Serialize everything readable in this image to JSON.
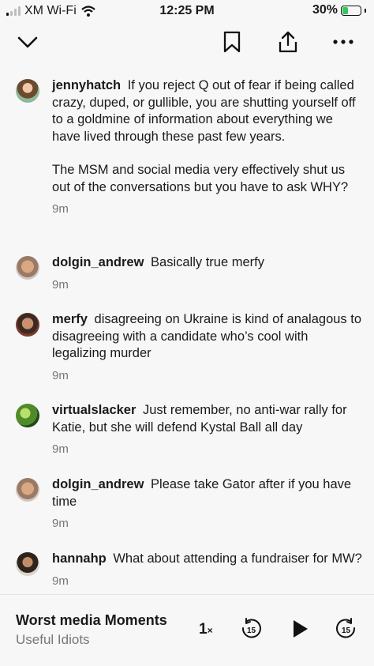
{
  "status_bar": {
    "carrier": "XM Wi-Fi",
    "time": "12:25 PM",
    "battery": "30%"
  },
  "topbar": {
    "icons": [
      "chevron-down-icon",
      "bookmark-icon",
      "share-icon",
      "more-icon"
    ]
  },
  "comments": [
    {
      "user": "jennyhatch",
      "text": "If you reject Q out of fear if being called crazy, duped, or gullible, you are shutting yourself off to a goldmine of information about everything we have lived through these past few years.",
      "text2": "The MSM and social media very effectively shut us out of the conversations but you have to ask WHY?",
      "time": "9m"
    },
    {
      "user": "dolgin_andrew",
      "text": "Basically true merfy",
      "time": "9m"
    },
    {
      "user": "merfy",
      "text": "disagreeing on Ukraine is kind of analagous to disagreeing with a candidate who’s cool with legalizing murder",
      "time": "9m"
    },
    {
      "user": "virtualslacker",
      "text": "Just remember, no anti-war rally for Katie, but she will defend Kystal Ball all day",
      "time": "9m"
    },
    {
      "user": "dolgin_andrew",
      "text": "Please take Gator after if you have time",
      "time": "9m"
    },
    {
      "user": "hannahp",
      "text": "What about attending a fundraiser for MW?",
      "time": "9m"
    }
  ],
  "player": {
    "episode_title": "Worst media Moments",
    "show_name": "Useful Idiots",
    "speed": "1",
    "speed_suffix": "×",
    "skip_back_seconds": "15",
    "skip_forward_seconds": "15"
  }
}
